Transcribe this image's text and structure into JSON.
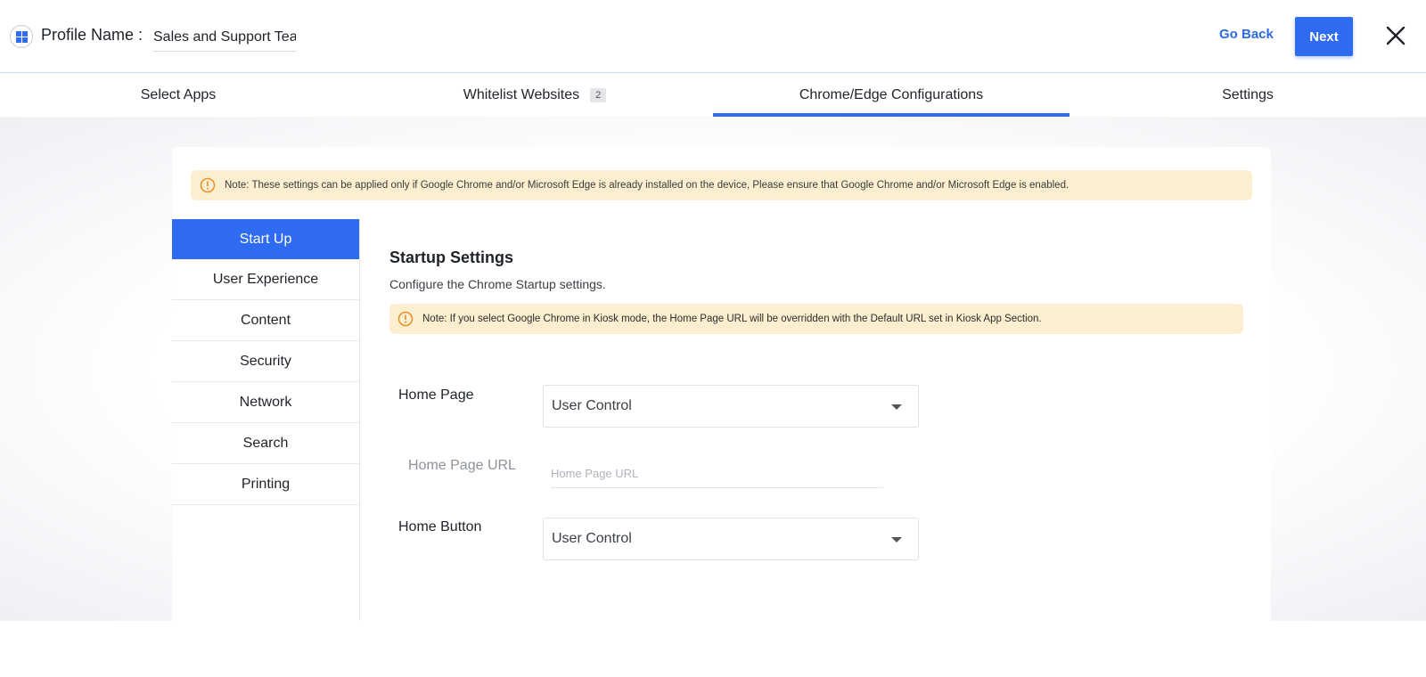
{
  "header": {
    "profile_label": "Profile Name :",
    "profile_value": "Sales and Support Tea",
    "go_back_label": "Go Back",
    "next_label": "Next",
    "accent_color": "#2e6bf0"
  },
  "tabs": [
    {
      "label": "Select Apps",
      "badge": null
    },
    {
      "label": "Whitelist Websites",
      "badge": "2"
    },
    {
      "label": "Chrome/Edge Configurations",
      "badge": null,
      "active": true
    },
    {
      "label": "Settings",
      "badge": null
    }
  ],
  "note_top": "Note: These settings can be applied only if Google Chrome and/or Microsoft Edge is already installed on the device, Please ensure that Google Chrome and/or Microsoft Edge is enabled.",
  "side_menu": [
    {
      "label": "Start Up",
      "active": true
    },
    {
      "label": "User Experience"
    },
    {
      "label": "Content"
    },
    {
      "label": "Security"
    },
    {
      "label": "Network"
    },
    {
      "label": "Search"
    },
    {
      "label": "Printing"
    }
  ],
  "startup": {
    "title": "Startup Settings",
    "subtitle": "Configure the Chrome Startup settings.",
    "note": "Note: If you select Google Chrome in Kiosk mode, the Home Page URL will be overridden with the Default URL set in Kiosk App Section.",
    "home_page_label": "Home Page",
    "home_page_value": "User Control",
    "home_page_url_label": "Home Page URL",
    "home_page_url_placeholder": "Home Page URL",
    "home_button_label": "Home Button",
    "home_button_value": "User Control"
  }
}
